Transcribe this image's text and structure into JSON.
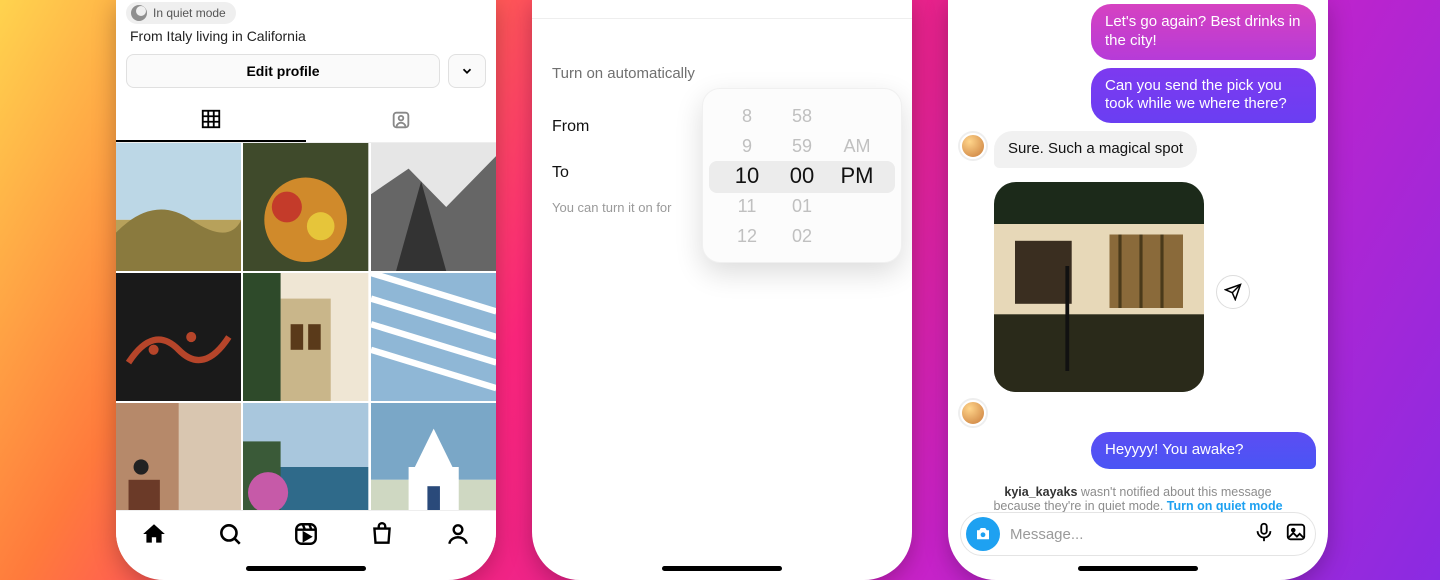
{
  "phone1": {
    "quiet_badge": "In quiet mode",
    "bio": "From Italy living in California",
    "edit_profile": "Edit profile",
    "tabs": {
      "grid": "Posts grid",
      "tagged": "Tagged"
    },
    "nav": {
      "home": "Home",
      "search": "Search",
      "reels": "Reels",
      "shop": "Shop",
      "profile": "Profile"
    }
  },
  "phone2": {
    "section_title": "Turn on automatically",
    "from_label": "From",
    "to_label": "To",
    "footnote": "You can turn it on for",
    "picker": {
      "hours": [
        "8",
        "9",
        "10",
        "11",
        "12"
      ],
      "minutes": [
        "58",
        "59",
        "00",
        "01",
        "02"
      ],
      "ampm": [
        "",
        "AM",
        "PM",
        "",
        ""
      ],
      "selected": {
        "hour": "10",
        "minute": "00",
        "ampm": "PM"
      }
    }
  },
  "phone3": {
    "messages": {
      "m1": "Let's go again? Best drinks in the city!",
      "m2": "Can you send the pick you took while we where there?",
      "m3": "Sure. Such a magical spot",
      "m4": "Heyyyy! You awake?"
    },
    "notice_user": "kyia_kayaks",
    "notice_text_a": " wasn't notified about this message because they're in quiet mode. ",
    "notice_link": "Turn on quiet mode",
    "composer_placeholder": "Message..."
  }
}
